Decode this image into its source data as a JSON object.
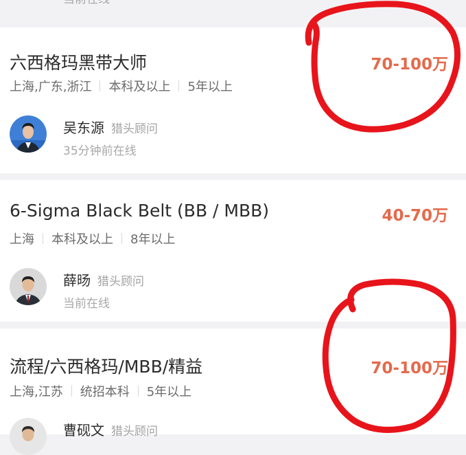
{
  "top_fragment": "当前在线",
  "jobs": [
    {
      "title": "六西格玛黑带大师",
      "salary": "70-100万",
      "tags": [
        "上海,广东,浙江",
        "本科及以上",
        "5年以上"
      ],
      "hunter": {
        "name": "吴东源",
        "role": "猎头顾问",
        "status": "35分钟前在线"
      }
    },
    {
      "title": "6-Sigma Black Belt (BB / MBB)",
      "salary": "40-70万",
      "tags": [
        "上海",
        "本科及以上",
        "8年以上"
      ],
      "hunter": {
        "name": "薛旸",
        "role": "猎头顾问",
        "status": "当前在线"
      }
    },
    {
      "title": "流程/六西格玛/MBB/精益",
      "salary": "70-100万",
      "tags": [
        "上海,江苏",
        "统招本科",
        "5年以上"
      ],
      "hunter": {
        "name": "曹砚文",
        "role": "猎头顾问",
        "status": ""
      }
    }
  ],
  "colors": {
    "salary": "#e46a4b",
    "annotation": "#e8141b"
  }
}
